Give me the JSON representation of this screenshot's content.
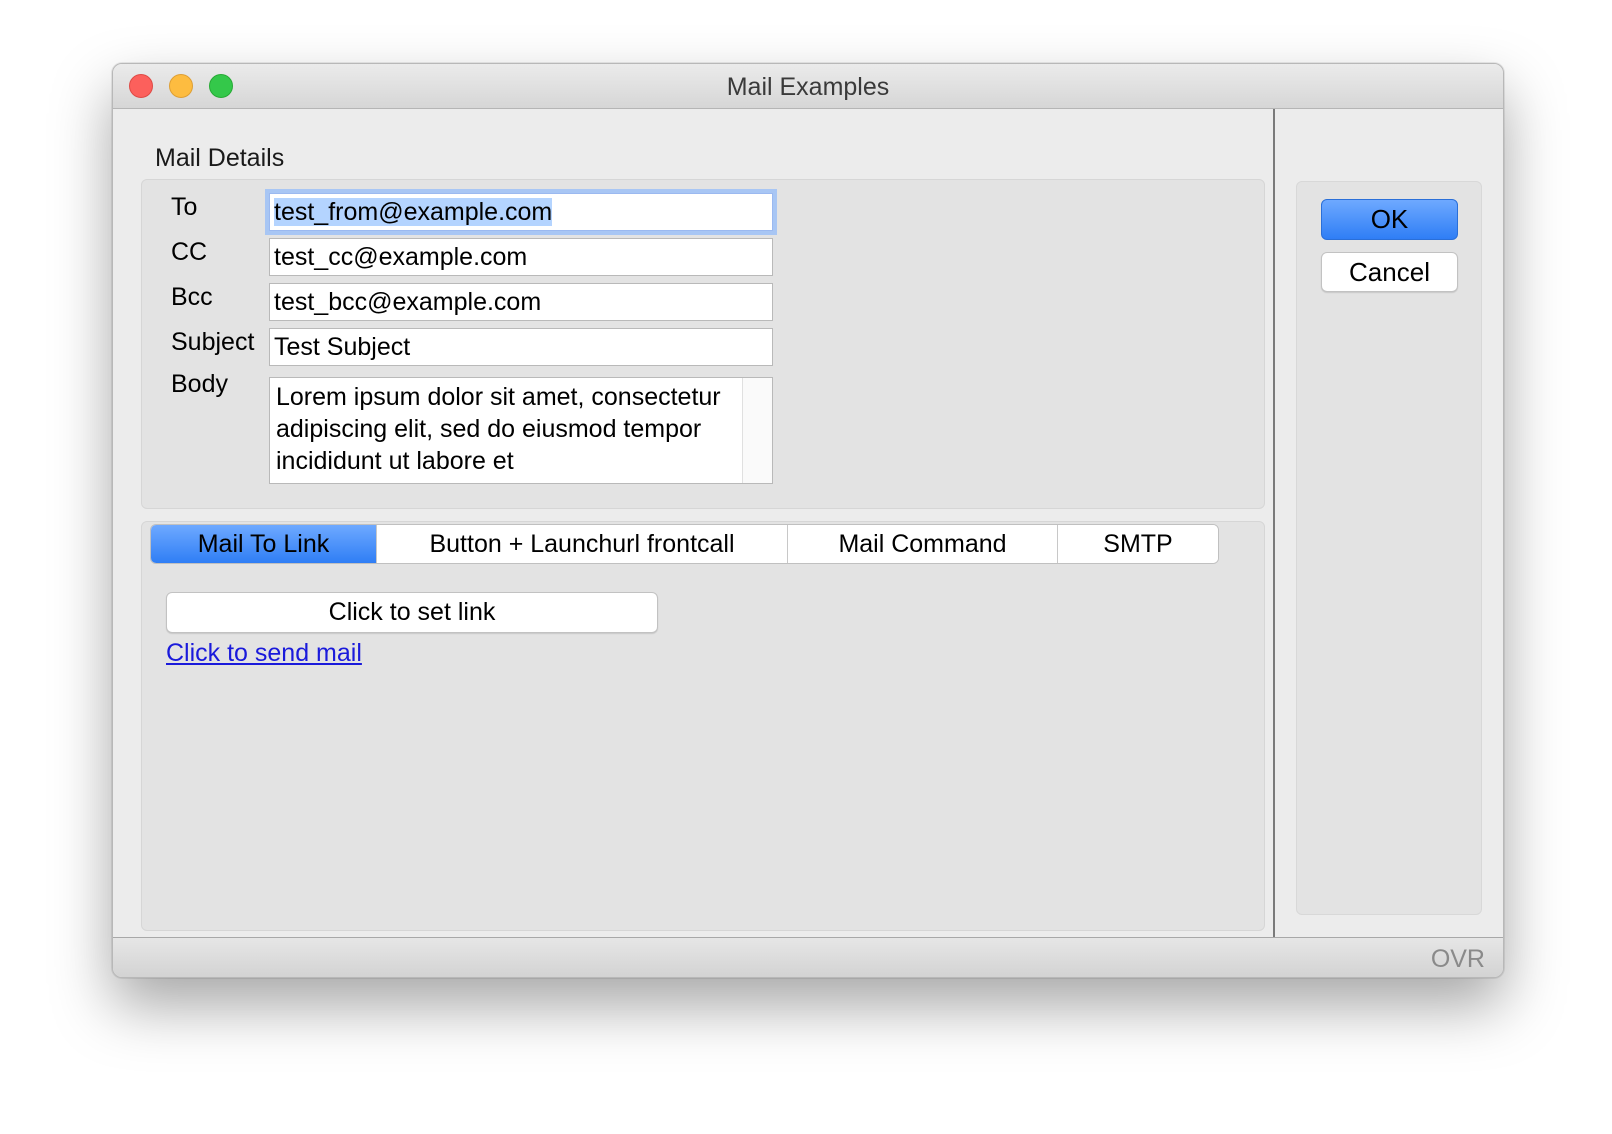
{
  "window": {
    "title": "Mail Examples"
  },
  "mail_details": {
    "group_title": "Mail Details",
    "to_label": "To",
    "to_value": "test_from@example.com",
    "cc_label": "CC",
    "cc_value": "test_cc@example.com",
    "bcc_label": "Bcc",
    "bcc_value": "test_bcc@example.com",
    "subject_label": "Subject",
    "subject_value": "Test Subject",
    "body_label": "Body",
    "body_value": "Lorem ipsum dolor sit amet, consectetur adipiscing elit, sed do eiusmod tempor incididunt ut labore et"
  },
  "tabs": [
    {
      "label": "Mail To Link",
      "active": true
    },
    {
      "label": "Button + Launchurl frontcall",
      "active": false
    },
    {
      "label": "Mail Command",
      "active": false
    },
    {
      "label": "SMTP",
      "active": false
    }
  ],
  "mail_to_link": {
    "set_link_label": "Click to set link",
    "send_mail_label": "Click to send mail"
  },
  "actions": {
    "ok_label": "OK",
    "cancel_label": "Cancel"
  },
  "statusbar": {
    "mode": "OVR"
  },
  "colors": {
    "accent": "#2f7ef5",
    "link": "#1a1adb",
    "selection": "#b4d4ff",
    "close": "#fc605c",
    "minimize": "#fdbc40",
    "maximize": "#34c84a"
  },
  "icons": {
    "close": "close-icon",
    "minimize": "minimize-icon",
    "maximize": "maximize-icon"
  }
}
